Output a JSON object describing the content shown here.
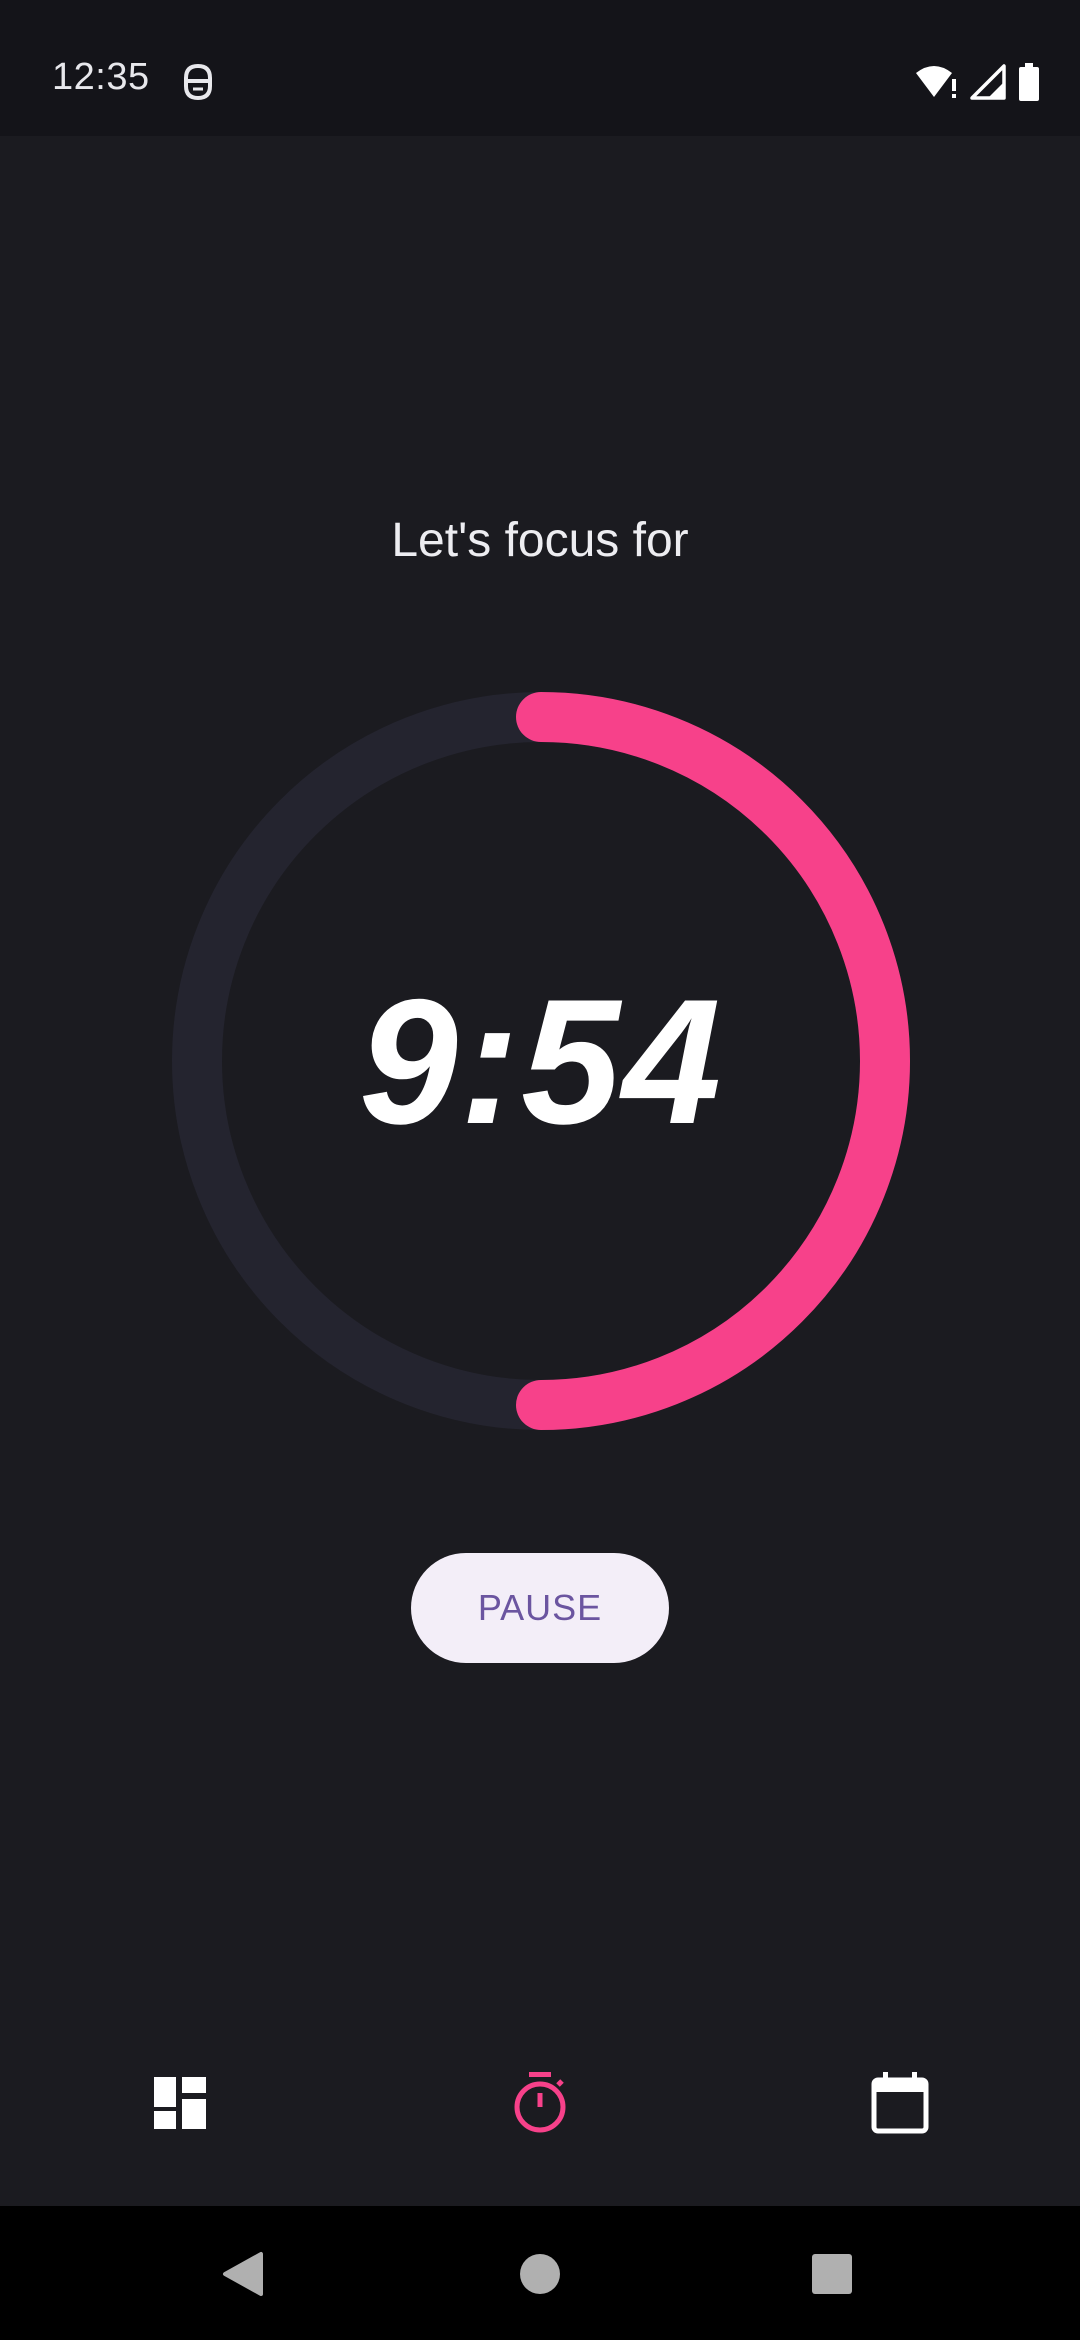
{
  "status_bar": {
    "time": "12:35",
    "app_notification_icon": "robot-face-icon",
    "icons": [
      "wifi-alert-icon",
      "cell-signal-icon",
      "battery-icon"
    ]
  },
  "focus": {
    "title": "Let's focus for",
    "time_remaining": "9:54",
    "progress_fraction": 0.5,
    "progress_color": "#f7418a",
    "track_color": "#24242f",
    "pause_label": "PAUSE"
  },
  "bottom_nav": {
    "items": [
      {
        "icon": "dashboard-icon",
        "active": false
      },
      {
        "icon": "timer-icon",
        "active": true
      },
      {
        "icon": "calendar-icon",
        "active": false
      }
    ],
    "active_color": "#f7418a"
  },
  "system_nav": {
    "icons": [
      "back-icon",
      "home-icon",
      "recents-icon"
    ]
  }
}
